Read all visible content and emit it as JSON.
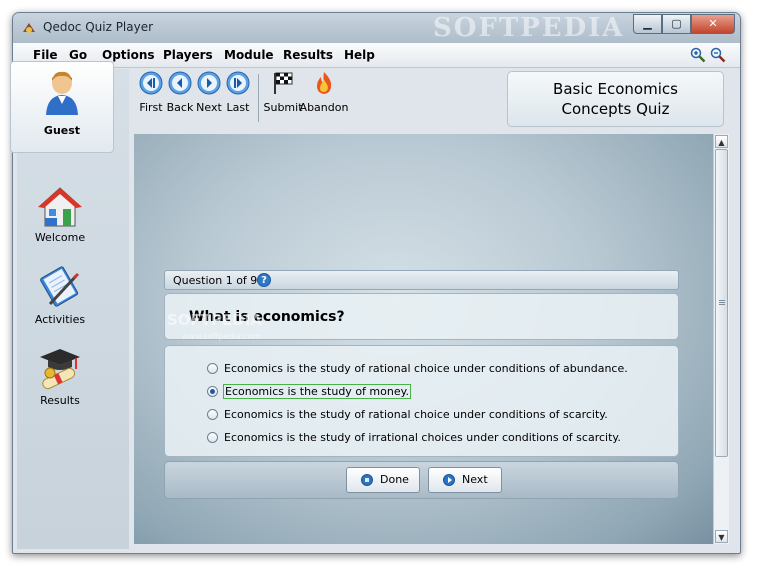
{
  "window": {
    "title": "Qedoc Quiz Player",
    "watermark": "SOFTPEDIA"
  },
  "menu": [
    "File",
    "Go",
    "Options",
    "Players",
    "Module",
    "Results",
    "Help"
  ],
  "zoom": {
    "in_icon": "zoom-in-icon",
    "out_icon": "zoom-out-icon"
  },
  "user": {
    "name": "Guest"
  },
  "sidebar": {
    "items": [
      {
        "label": "Welcome",
        "icon": "house-icon"
      },
      {
        "label": "Activities",
        "icon": "notebook-pen-icon"
      },
      {
        "label": "Results",
        "icon": "graduation-cap-icon"
      }
    ]
  },
  "toolbar": {
    "first": "First",
    "back": "Back",
    "next": "Next",
    "last": "Last",
    "submit": "Submit",
    "abandon": "Abandon"
  },
  "quiz": {
    "title_line1": "Basic Economics",
    "title_line2": "Concepts Quiz"
  },
  "question": {
    "counter": "Question 1 of 9.",
    "text": "What is economics?",
    "options": [
      {
        "text": "Economics is the study of rational choice under conditions of abundance.",
        "selected": false
      },
      {
        "text": "Economics is the study of money.",
        "selected": true
      },
      {
        "text": "Economics is the study of rational choice under conditions of scarcity.",
        "selected": false
      },
      {
        "text": "Economics is the study of irrational choices under conditions of scarcity.",
        "selected": false
      }
    ]
  },
  "buttons": {
    "done": "Done",
    "next": "Next"
  },
  "overlay": {
    "softpedia": "SOFTPEDIA",
    "softpedia_url": "www.softpedia.com"
  },
  "colors": {
    "accent": "#2f78c8",
    "focus": "#49b04a",
    "close": "#c2452c"
  }
}
